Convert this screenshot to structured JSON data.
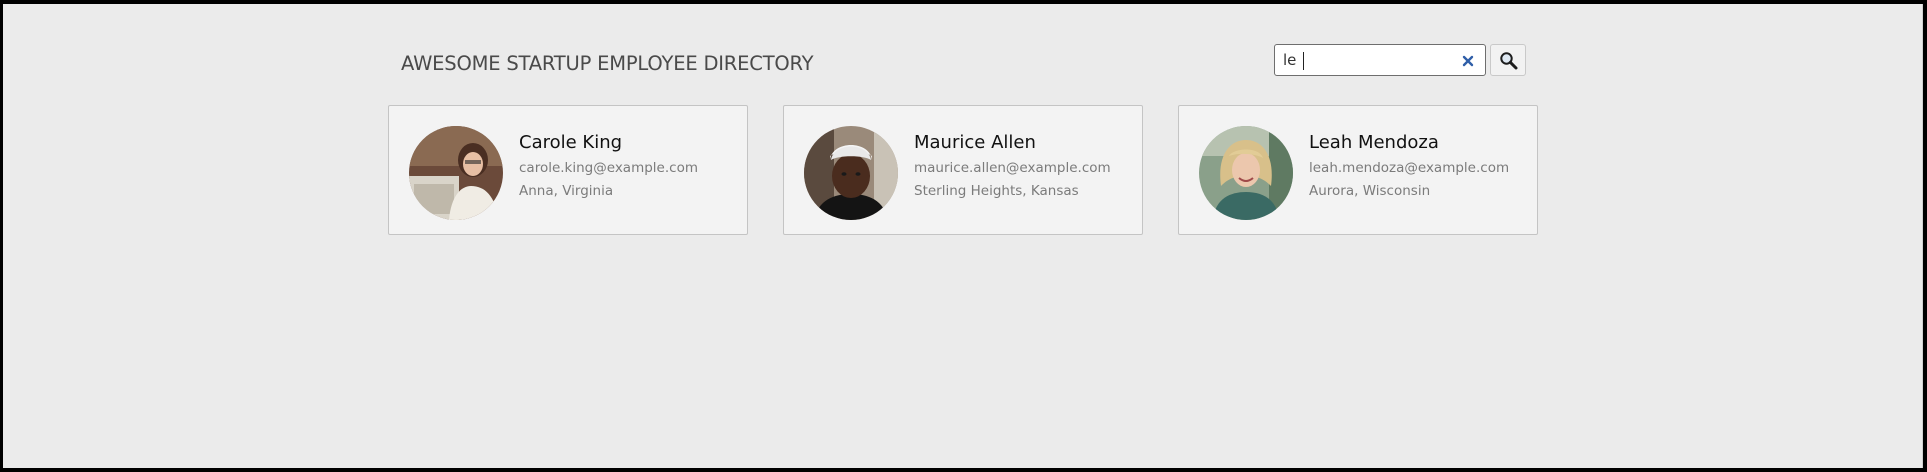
{
  "header": {
    "title": "AWESOME STARTUP EMPLOYEE DIRECTORY"
  },
  "search": {
    "value": "le",
    "clear_icon": "close-icon",
    "button_icon": "search-icon"
  },
  "employees": [
    {
      "name": "Carole King",
      "email": "carole.king@example.com",
      "location": "Anna, Virginia",
      "avatar_icon": "avatar-photo"
    },
    {
      "name": "Maurice Allen",
      "email": "maurice.allen@example.com",
      "location": "Sterling Heights, Kansas",
      "avatar_icon": "avatar-photo"
    },
    {
      "name": "Leah Mendoza",
      "email": "leah.mendoza@example.com",
      "location": "Aurora, Wisconsin",
      "avatar_icon": "avatar-photo"
    }
  ],
  "colors": {
    "background": "#ebebeb",
    "card_background": "#f3f3f3",
    "clear_icon": "#2f5ea8"
  }
}
